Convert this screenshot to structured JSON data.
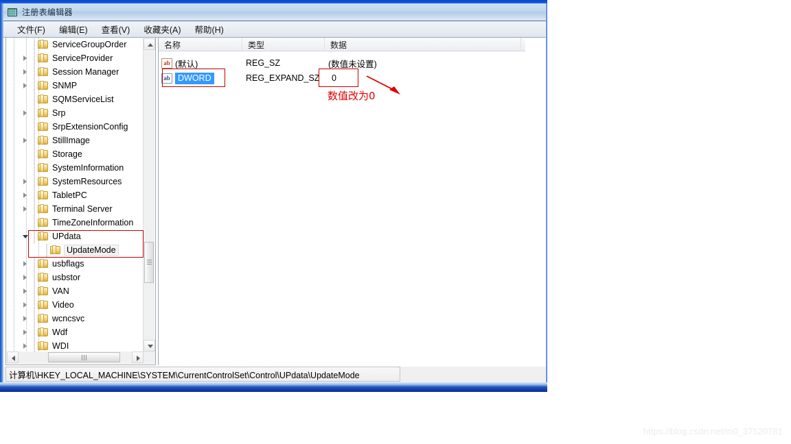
{
  "window": {
    "title": "注册表编辑器",
    "app_icon": "registry-editor-icon"
  },
  "menubar": {
    "items": [
      {
        "label": "文件(F)",
        "name": "menu-file"
      },
      {
        "label": "编辑(E)",
        "name": "menu-edit"
      },
      {
        "label": "查看(V)",
        "name": "menu-view"
      },
      {
        "label": "收藏夹(A)",
        "name": "menu-favorites"
      },
      {
        "label": "帮助(H)",
        "name": "menu-help"
      }
    ]
  },
  "tree": {
    "items": [
      {
        "label": "ServiceGroupOrder",
        "indent": 1,
        "twisty": "none"
      },
      {
        "label": "ServiceProvider",
        "indent": 1,
        "twisty": "collapsed"
      },
      {
        "label": "Session Manager",
        "indent": 1,
        "twisty": "collapsed"
      },
      {
        "label": "SNMP",
        "indent": 1,
        "twisty": "collapsed"
      },
      {
        "label": "SQMServiceList",
        "indent": 1,
        "twisty": "none"
      },
      {
        "label": "Srp",
        "indent": 1,
        "twisty": "collapsed"
      },
      {
        "label": "SrpExtensionConfig",
        "indent": 1,
        "twisty": "none"
      },
      {
        "label": "StillImage",
        "indent": 1,
        "twisty": "collapsed"
      },
      {
        "label": "Storage",
        "indent": 1,
        "twisty": "none"
      },
      {
        "label": "SystemInformation",
        "indent": 1,
        "twisty": "none"
      },
      {
        "label": "SystemResources",
        "indent": 1,
        "twisty": "collapsed"
      },
      {
        "label": "TabletPC",
        "indent": 1,
        "twisty": "collapsed"
      },
      {
        "label": "Terminal Server",
        "indent": 1,
        "twisty": "collapsed"
      },
      {
        "label": "TimeZoneInformation",
        "indent": 1,
        "twisty": "none"
      },
      {
        "label": "UPdata",
        "indent": 1,
        "twisty": "expanded"
      },
      {
        "label": "UpdateMode",
        "indent": 2,
        "twisty": "none",
        "selected": true
      },
      {
        "label": "usbflags",
        "indent": 1,
        "twisty": "collapsed"
      },
      {
        "label": "usbstor",
        "indent": 1,
        "twisty": "collapsed"
      },
      {
        "label": "VAN",
        "indent": 1,
        "twisty": "collapsed"
      },
      {
        "label": "Video",
        "indent": 1,
        "twisty": "collapsed"
      },
      {
        "label": "wcncsvc",
        "indent": 1,
        "twisty": "collapsed"
      },
      {
        "label": "Wdf",
        "indent": 1,
        "twisty": "collapsed"
      },
      {
        "label": "WDI",
        "indent": 1,
        "twisty": "collapsed"
      }
    ]
  },
  "list": {
    "columns": [
      "名称",
      "类型",
      "数据"
    ],
    "rows": [
      {
        "name": "(默认)",
        "type": "REG_SZ",
        "data": "(数值未设置)",
        "selected": false
      },
      {
        "name": "DWORD",
        "type": "REG_EXPAND_SZ",
        "data": "0",
        "selected": true
      }
    ]
  },
  "annotation": {
    "caption": "数值改为0",
    "color": "#e00000"
  },
  "statusbar": {
    "path": "计算机\\HKEY_LOCAL_MACHINE\\SYSTEM\\CurrentControlSet\\Control\\UPdata\\UpdateMode"
  },
  "watermark": {
    "text": "https://blog.csdn.net/m0_37520781"
  }
}
